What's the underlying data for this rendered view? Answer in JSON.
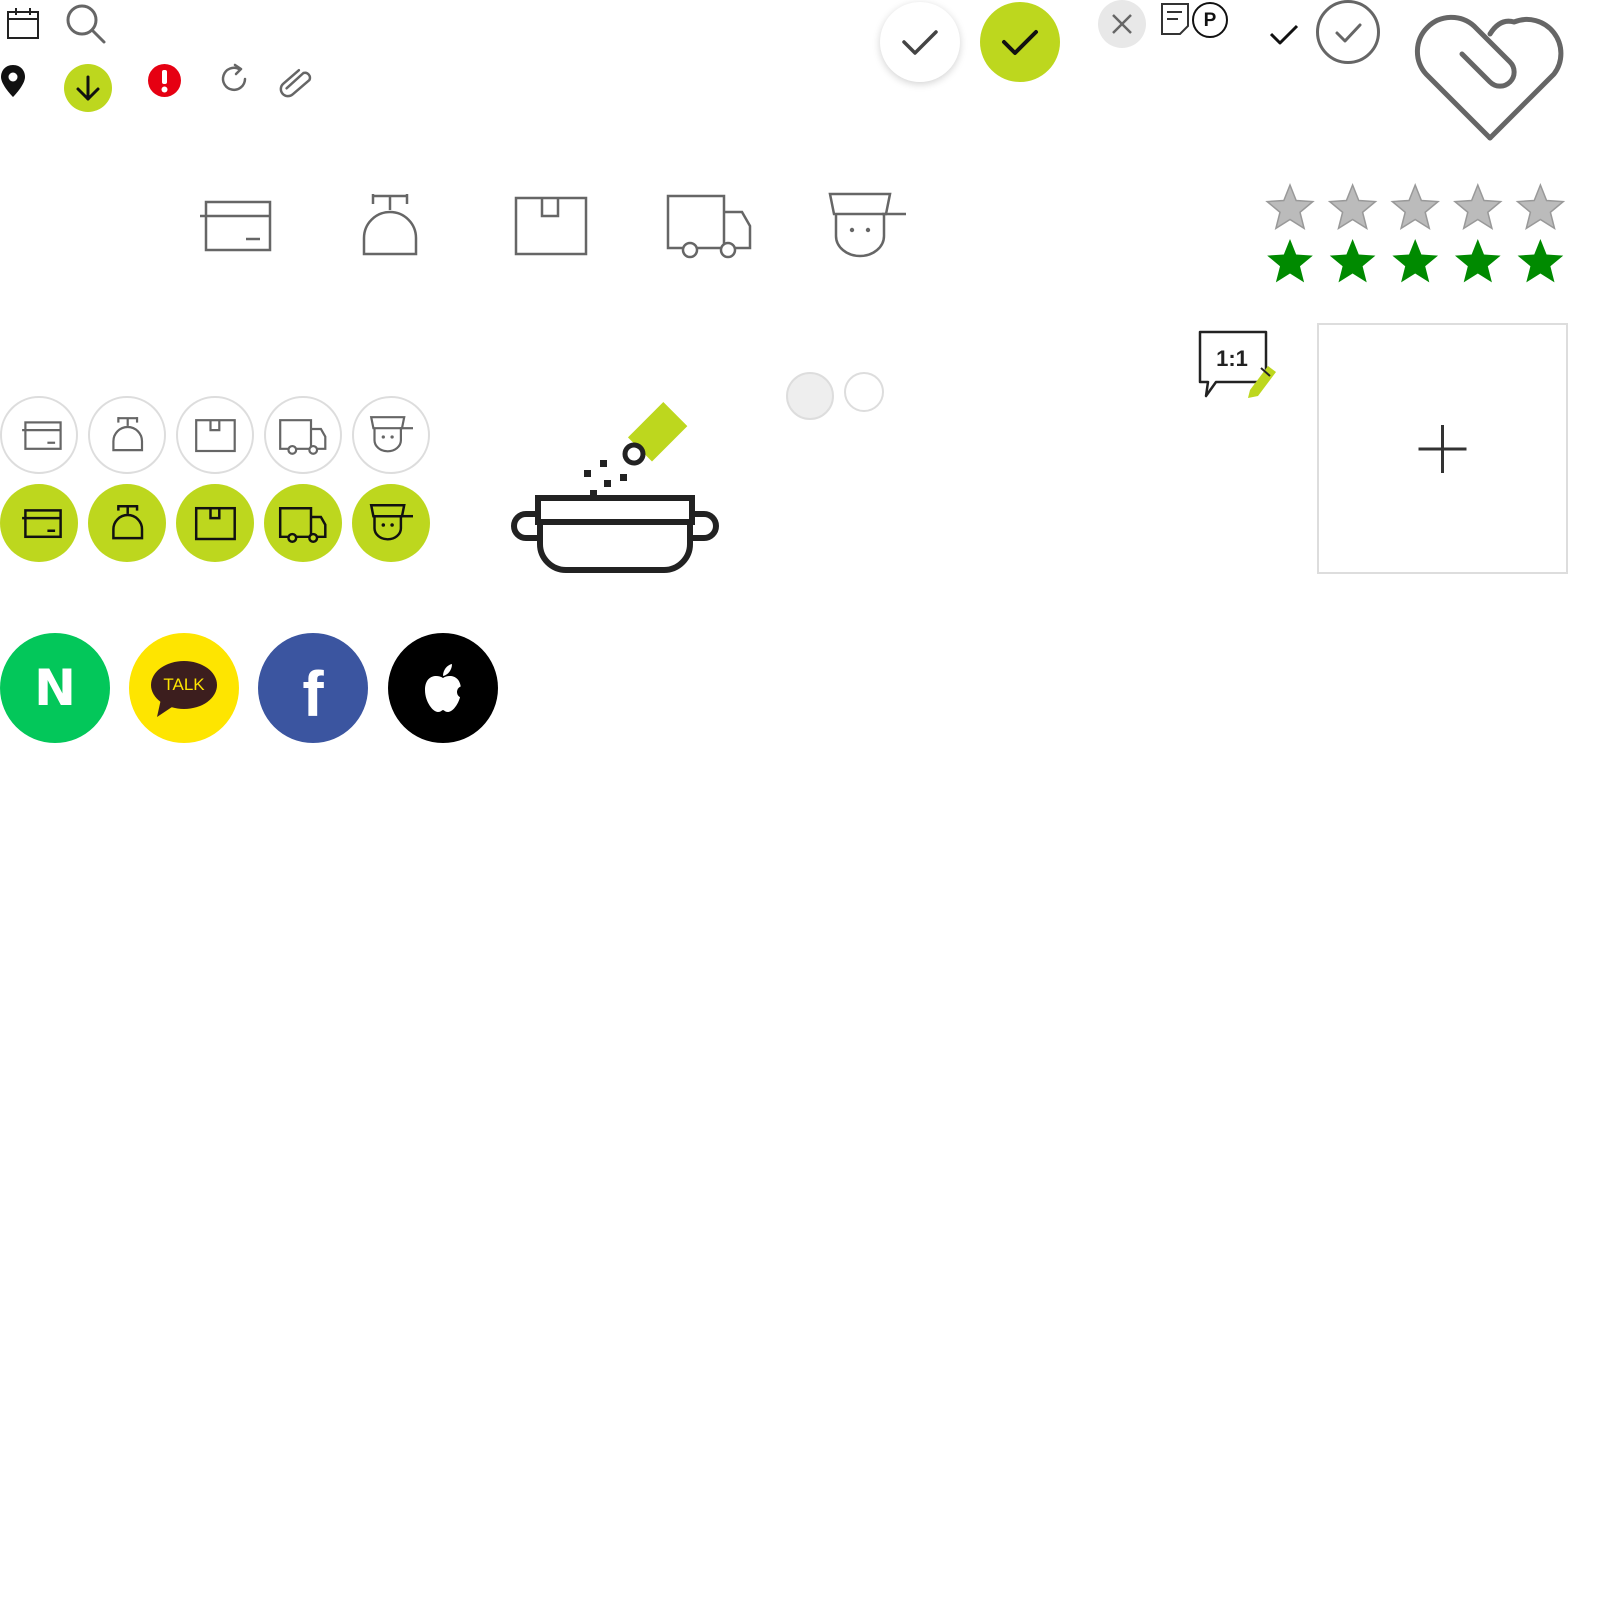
{
  "colors": {
    "accent": "#bdd71e",
    "dark": "#222222",
    "grey": "#666666",
    "light_border": "#dddddd",
    "error": "#e60012",
    "star_empty": "#bbbbbb",
    "star_filled": "#008a00",
    "naver": "#03c75a",
    "kakao": "#fee500",
    "kakao_bubble": "#3c1e1e",
    "facebook": "#3b55a0",
    "apple": "#000000"
  },
  "icons": {
    "row1": [
      "calendar-icon",
      "search-icon"
    ],
    "row2": [
      "location-pin-icon",
      "download-icon",
      "alert-icon",
      "refresh-icon",
      "paperclip-icon"
    ],
    "checks": [
      "check-circle-white-icon",
      "check-circle-accent-icon"
    ],
    "top_right": [
      "close-circle-icon",
      "document-icon",
      "point-icon",
      "check-icon",
      "check-circle-outline-icon",
      "heart-clip-icon"
    ],
    "order_steps": [
      "card-icon",
      "scale-icon",
      "box-icon",
      "truck-icon",
      "chef-icon"
    ],
    "misc": [
      "cooking-pot-icon",
      "one-to-one-chat-icon",
      "add-image-icon",
      "radio-filled-icon",
      "radio-empty-icon"
    ]
  },
  "rating": {
    "empty_count": 5,
    "filled_count": 5
  },
  "point_label": "P",
  "chat_label": "1:1",
  "social": {
    "naver_label": "N",
    "kakao_label": "TALK",
    "facebook_label": "f"
  }
}
